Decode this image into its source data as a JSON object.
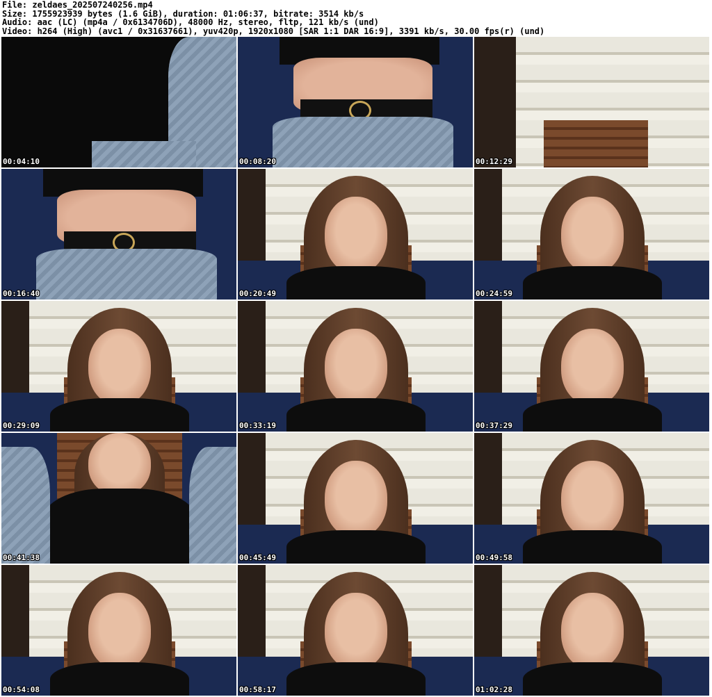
{
  "header": {
    "line1": "File: zeldaes_202507240256.mp4",
    "line2": "Size: 1755923939 bytes (1.6 GiB), duration: 01:06:37, bitrate: 3514 kb/s",
    "line3": "Audio: aac (LC) (mp4a / 0x6134706D), 48000 Hz, stereo, fltp, 121 kb/s (und)",
    "line4": "Video: h264 (High) (avc1 / 0x31637661), yuv420p, 1920x1080 [SAR 1:1 DAR 16:9], 3391 kb/s, 30.00 fps(r) (und)"
  },
  "thumbnails": [
    {
      "timestamp": "00:04:10",
      "scene": "closeup-torso"
    },
    {
      "timestamp": "00:08:20",
      "scene": "closeup-belt"
    },
    {
      "timestamp": "00:12:29",
      "scene": "chair-wall"
    },
    {
      "timestamp": "00:16:40",
      "scene": "closeup-belt"
    },
    {
      "timestamp": "00:20:49",
      "scene": "portrait"
    },
    {
      "timestamp": "00:24:59",
      "scene": "portrait"
    },
    {
      "timestamp": "00:29:09",
      "scene": "portrait"
    },
    {
      "timestamp": "00:33:19",
      "scene": "portrait"
    },
    {
      "timestamp": "00:37:29",
      "scene": "portrait"
    },
    {
      "timestamp": "00:41:38",
      "scene": "portrait-jeans"
    },
    {
      "timestamp": "00:45:49",
      "scene": "portrait"
    },
    {
      "timestamp": "00:49:58",
      "scene": "portrait"
    },
    {
      "timestamp": "00:54:08",
      "scene": "portrait"
    },
    {
      "timestamp": "00:58:17",
      "scene": "portrait"
    },
    {
      "timestamp": "01:02:28",
      "scene": "portrait"
    }
  ]
}
